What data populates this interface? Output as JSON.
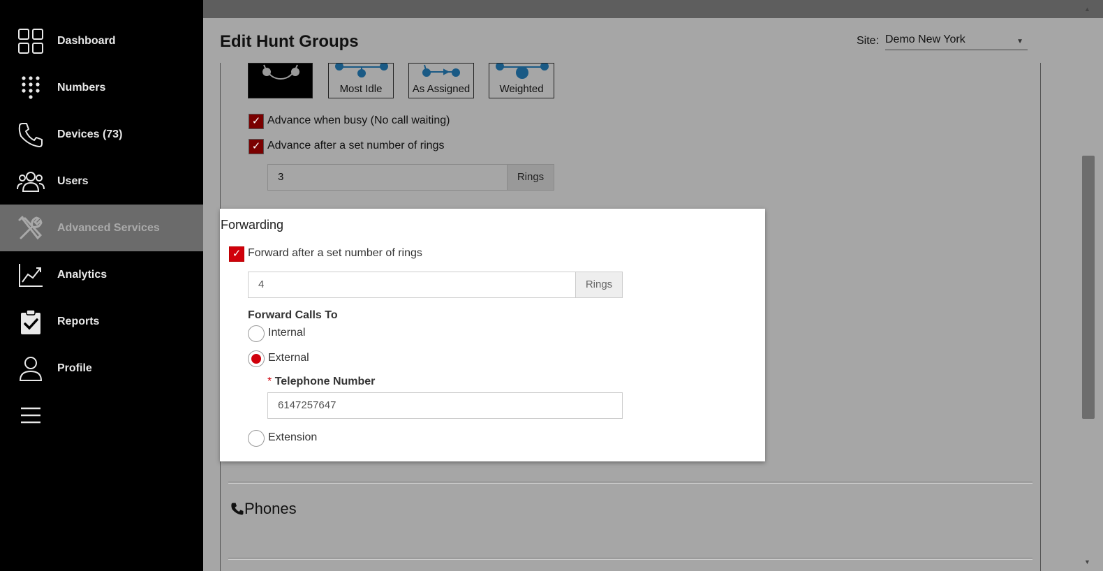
{
  "sidebar": {
    "items": [
      {
        "label": "Dashboard",
        "icon": "dashboard-grid-icon"
      },
      {
        "label": "Numbers",
        "icon": "dialpad-icon"
      },
      {
        "label": "Devices (73)",
        "icon": "phone-icon"
      },
      {
        "label": "Users",
        "icon": "users-icon"
      },
      {
        "label": "Advanced Services",
        "icon": "tools-icon",
        "active": true
      },
      {
        "label": "Analytics",
        "icon": "chart-icon"
      },
      {
        "label": "Reports",
        "icon": "clipboard-check-icon"
      },
      {
        "label": "Profile",
        "icon": "person-icon"
      },
      {
        "label": "",
        "icon": "hamburger-menu-icon"
      }
    ]
  },
  "header": {
    "title": "Edit Hunt Groups",
    "site_label": "Site:",
    "site_value": "Demo New York"
  },
  "strategies": [
    "Most Idle",
    "As Assigned",
    "Weighted"
  ],
  "options": {
    "advance_busy": "Advance when busy (No call waiting)",
    "advance_rings": "Advance after a set number of rings",
    "rings_value": "3",
    "rings_unit": "Rings"
  },
  "forwarding": {
    "title": "Forwarding",
    "forward_rings_label": "Forward after a set number of rings",
    "rings_value": "4",
    "rings_unit": "Rings",
    "forward_calls_to": "Forward Calls To",
    "internal": "Internal",
    "external": "External",
    "required_mark": "*",
    "telephone_label": "Telephone Number",
    "telephone_value": "6147257647",
    "extension": "Extension"
  },
  "phones": {
    "title": "Phones"
  },
  "colors": {
    "accent": "#d0000b",
    "sidebar_bg": "#000000",
    "overlay": "#a6a6a6"
  }
}
